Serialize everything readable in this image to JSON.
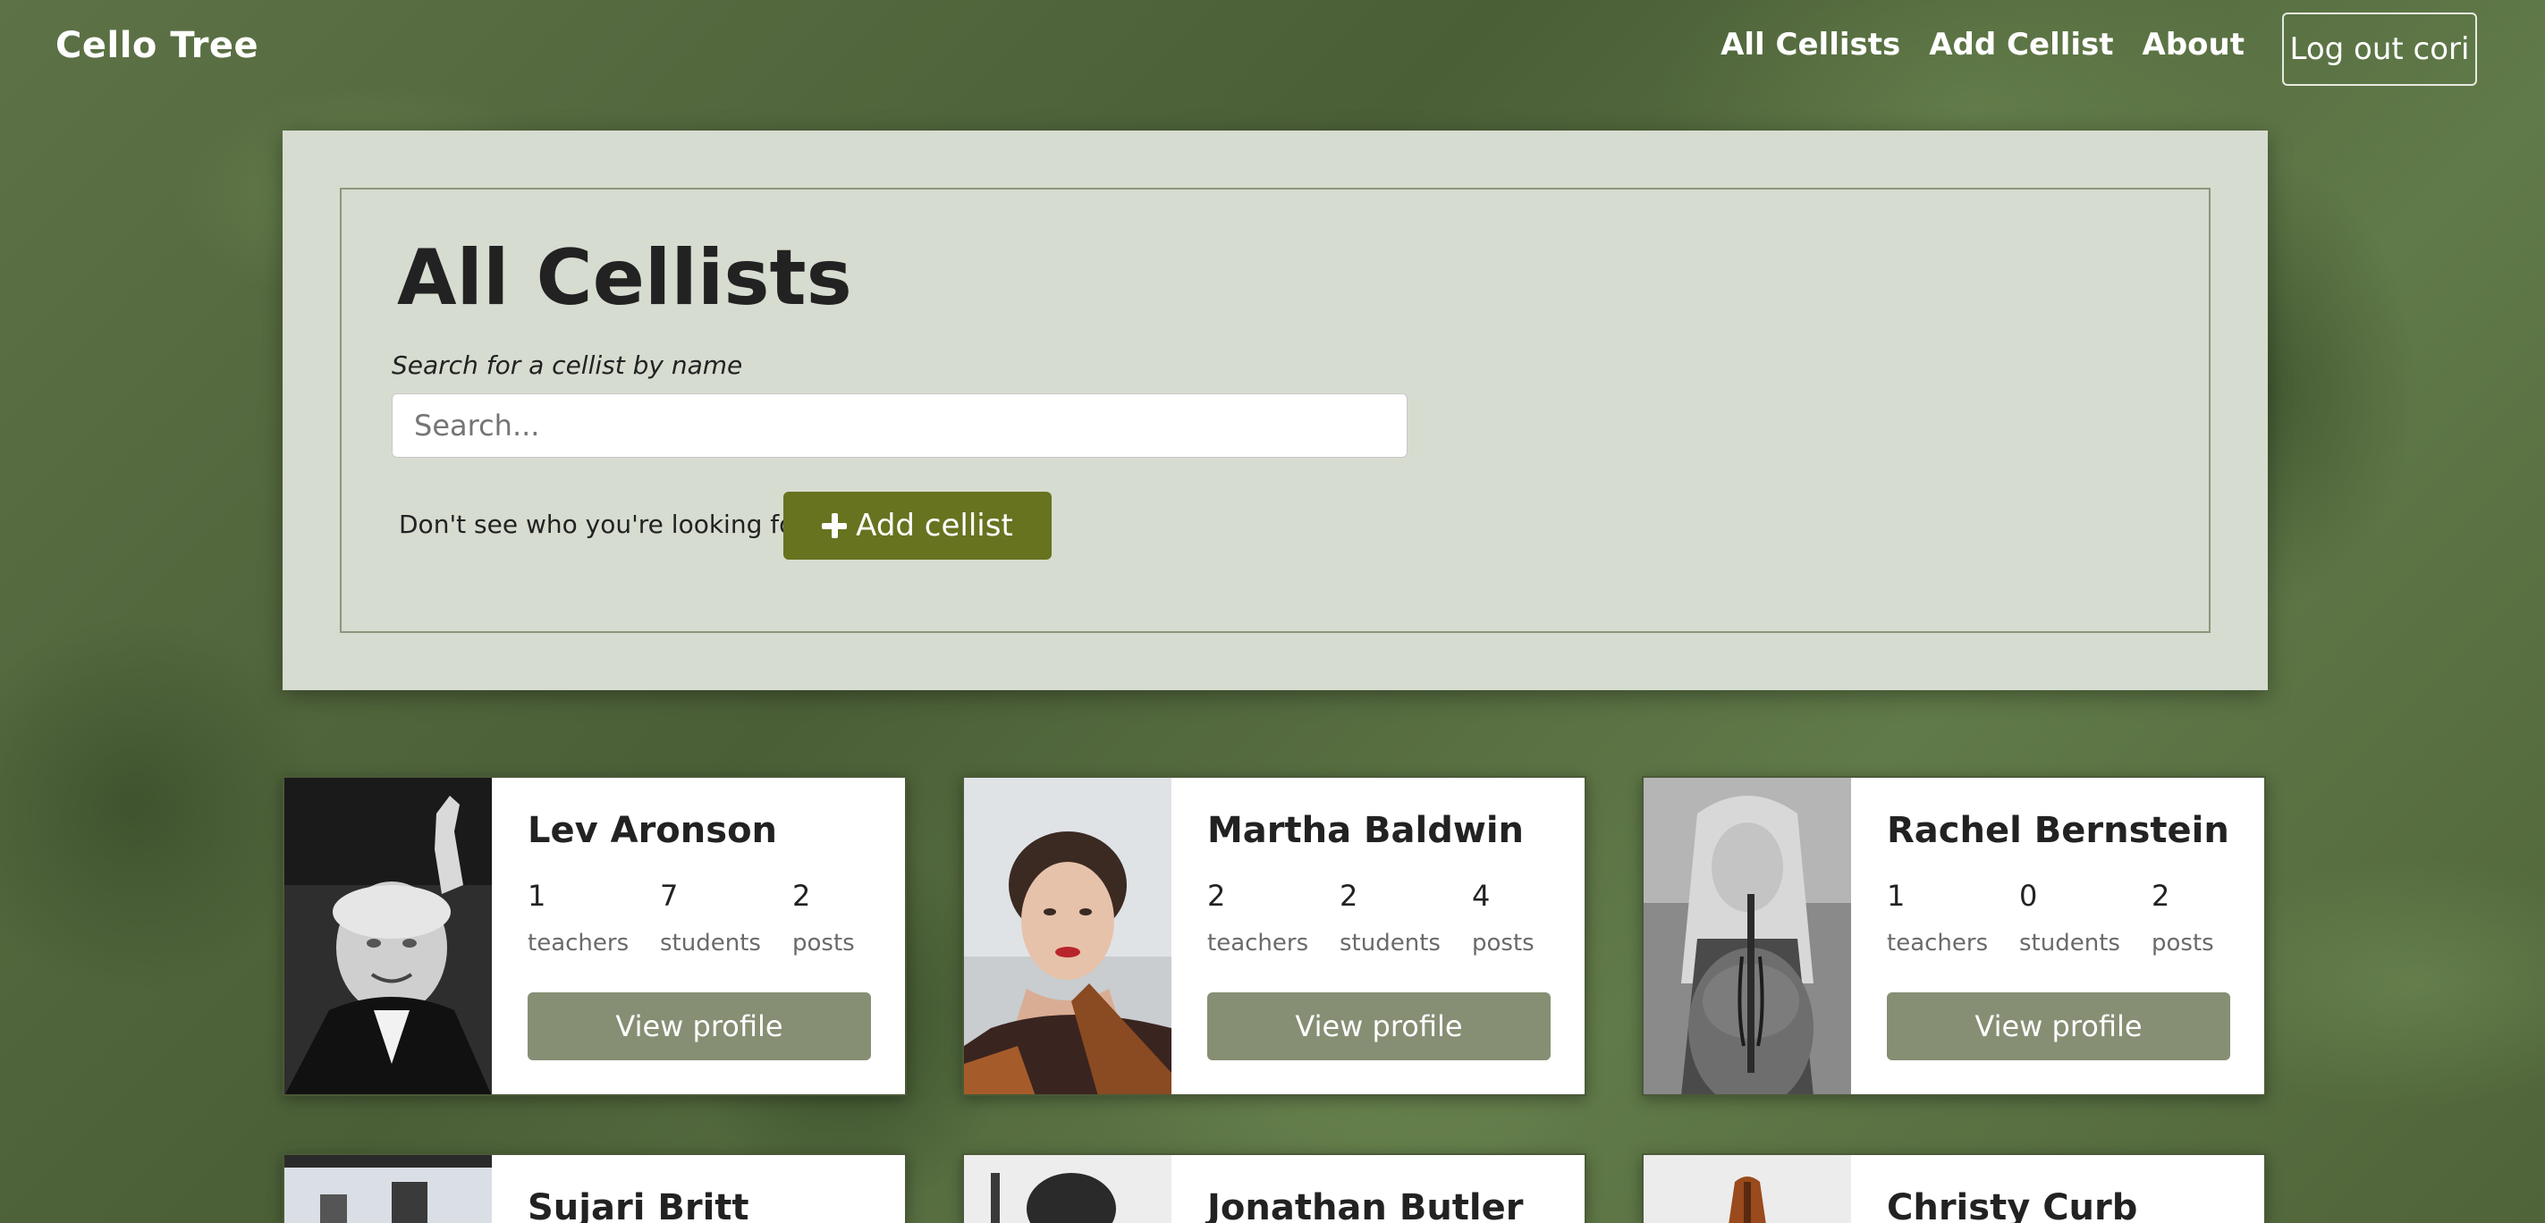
{
  "nav": {
    "brand": "Cello Tree",
    "links": [
      "All Cellists",
      "Add Cellist",
      "About"
    ],
    "logout_label": "Log out cori"
  },
  "hero": {
    "title": "All Cellists",
    "search_label": "Search for a cellist by name",
    "search_placeholder": "Search...",
    "search_value": "",
    "missing_text": "Don't see who you're looking for?",
    "add_button_label": "Add cellist"
  },
  "colors": {
    "add_button": "#67731f",
    "view_button": "#868f74",
    "panel_background": "#d6dcd0"
  },
  "cellists": [
    {
      "name": "Lev Aronson",
      "teachers": "1",
      "students": "7",
      "posts": "2",
      "view_label": "View profile",
      "photo": "bw-portrait"
    },
    {
      "name": "Martha Baldwin",
      "teachers": "2",
      "students": "2",
      "posts": "4",
      "view_label": "View profile",
      "photo": "color-portrait"
    },
    {
      "name": "Rachel Bernstein",
      "teachers": "1",
      "students": "0",
      "posts": "2",
      "view_label": "View profile",
      "photo": "bw-portrait-with-cello"
    },
    {
      "name": "Sujari Britt",
      "photo": "partial"
    },
    {
      "name": "Jonathan Butler",
      "photo": "partial"
    },
    {
      "name": "Christy Curb",
      "photo": "partial"
    }
  ],
  "stat_labels": {
    "teachers": "teachers",
    "students": "students",
    "posts": "posts"
  }
}
